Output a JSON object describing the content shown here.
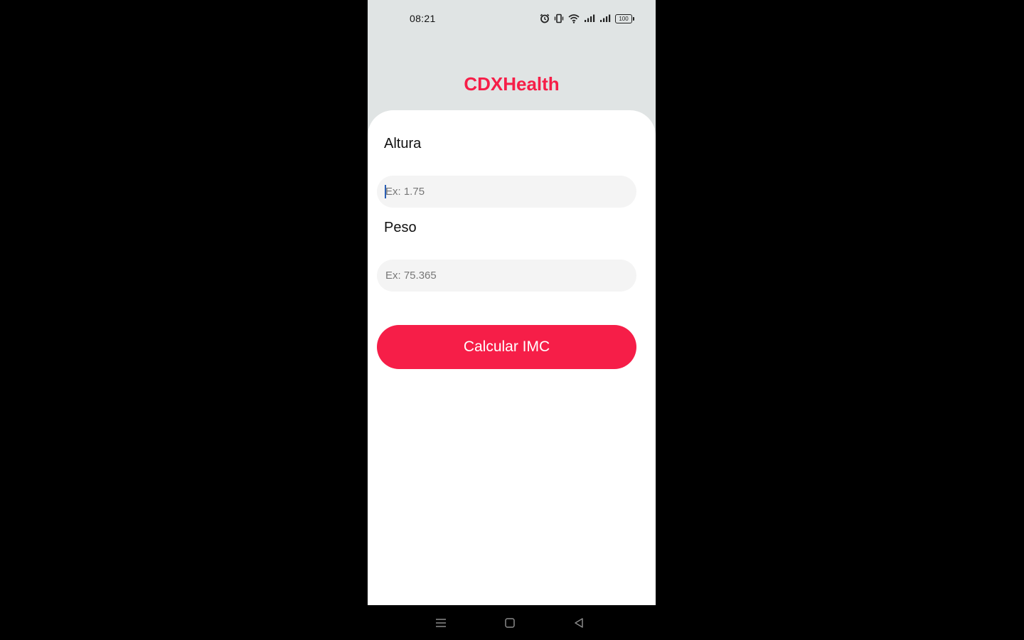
{
  "status_bar": {
    "time": "08:21",
    "battery": "100",
    "icons": [
      "alarm-icon",
      "vibrate-icon",
      "wifi-icon",
      "signal-icon",
      "signal-icon",
      "battery-icon"
    ]
  },
  "app": {
    "title": "CDXHealth"
  },
  "form": {
    "altura_label": "Altura",
    "altura_placeholder": "Ex: 1.75",
    "altura_value": "",
    "peso_label": "Peso",
    "peso_placeholder": "Ex: 75.365",
    "peso_value": "",
    "submit_label": "Calcular IMC"
  },
  "nav_bar": {
    "icons": [
      "menu-icon",
      "home-icon",
      "back-icon"
    ]
  },
  "colors": {
    "accent": "#f61e48",
    "header_background": "#e0e4e4",
    "card_background": "#ffffff",
    "input_background": "#f4f4f4"
  }
}
